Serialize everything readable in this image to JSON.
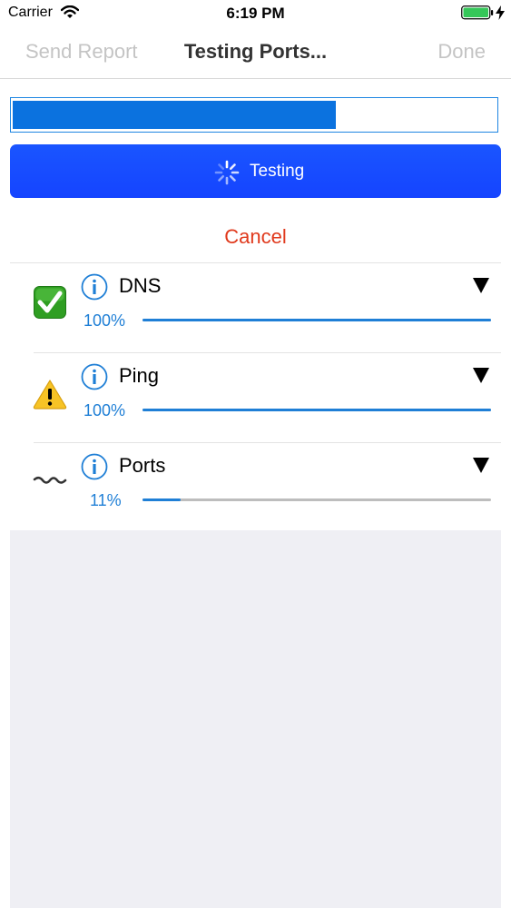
{
  "status_bar": {
    "carrier": "Carrier",
    "time": "6:19 PM"
  },
  "nav": {
    "left_button": "Send Report",
    "title": "Testing Ports...",
    "right_button": "Done"
  },
  "overall_progress": {
    "fraction": 0.67,
    "color": "#0b72df"
  },
  "testing_button": {
    "label": "Testing",
    "color": "#1544ff"
  },
  "cancel_label": "Cancel",
  "cancel_color": "#e0391c",
  "tests": [
    {
      "name": "DNS",
      "percent_label": "100%",
      "progress": 1.0,
      "status": "passed",
      "status_icon": "check-icon"
    },
    {
      "name": "Ping",
      "percent_label": "100%",
      "progress": 1.0,
      "status": "warning",
      "status_icon": "warning-icon"
    },
    {
      "name": "Ports",
      "percent_label": "11%",
      "progress": 0.11,
      "status": "running",
      "status_icon": "wave-icon"
    }
  ],
  "accent_color": "#1f7fd6"
}
